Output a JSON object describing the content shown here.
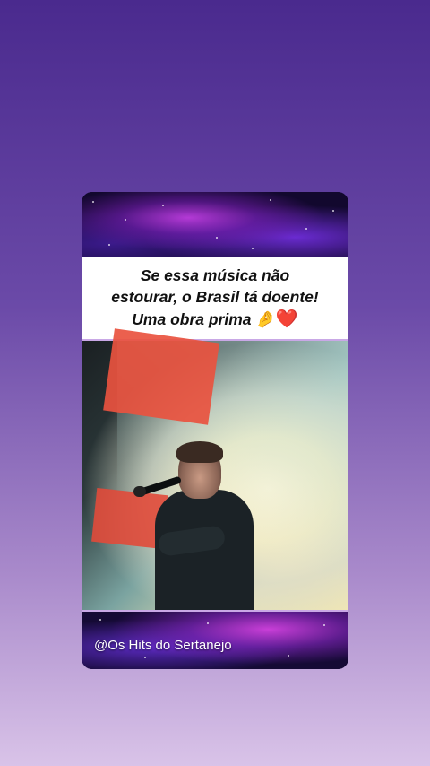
{
  "post": {
    "caption_line_1": "Se essa música não",
    "caption_line_2": "estourar, o Brasil tá doente!",
    "caption_line_3": "Uma obra prima",
    "caption_emoji_hand": "🤌",
    "caption_emoji_heart": "❤️",
    "account_handle": "@Os Hits do Sertanejo"
  },
  "colors": {
    "background_top": "#4a2a8e",
    "background_bottom": "#d9c3e8",
    "accent_border": "#c9a8e6"
  },
  "icons": [
    "pinched-fingers-emoji",
    "red-heart-emoji"
  ]
}
